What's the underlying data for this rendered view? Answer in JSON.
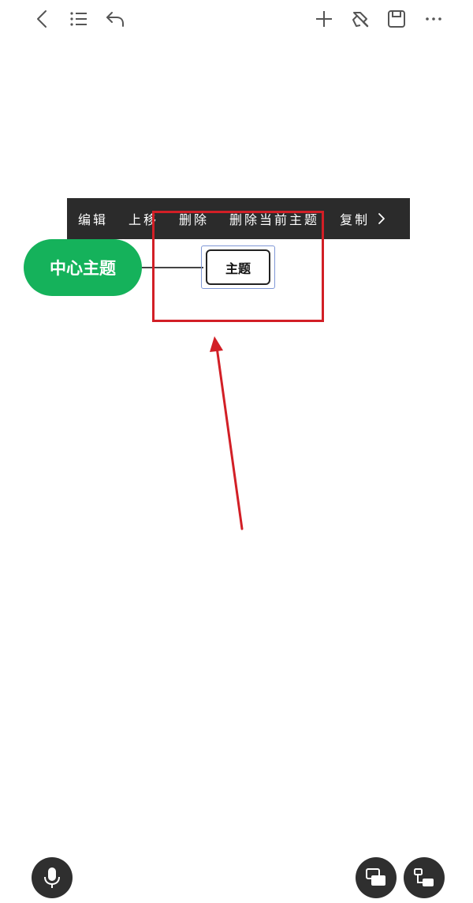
{
  "toolbar": {
    "icons": [
      "back-chevron-icon",
      "outline-list-icon",
      "undo-icon",
      "add-icon",
      "style-brush-icon",
      "save-icon",
      "more-icon"
    ]
  },
  "context_menu": {
    "items": [
      "编辑",
      "上移",
      "删除",
      "删除当前主题",
      "复制"
    ],
    "more_icon": "chevron-right-icon"
  },
  "mindmap": {
    "central_topic": "中心主题",
    "sub_topic": "主题"
  },
  "colors": {
    "central_topic": "#15b25b",
    "context_menu_bg": "#2b2b2b",
    "annotation": "#d21f26",
    "selection": "#7f97d6"
  },
  "bottom_bar": {
    "icons": [
      "microphone-icon",
      "layout-icon",
      "structure-icon"
    ]
  }
}
